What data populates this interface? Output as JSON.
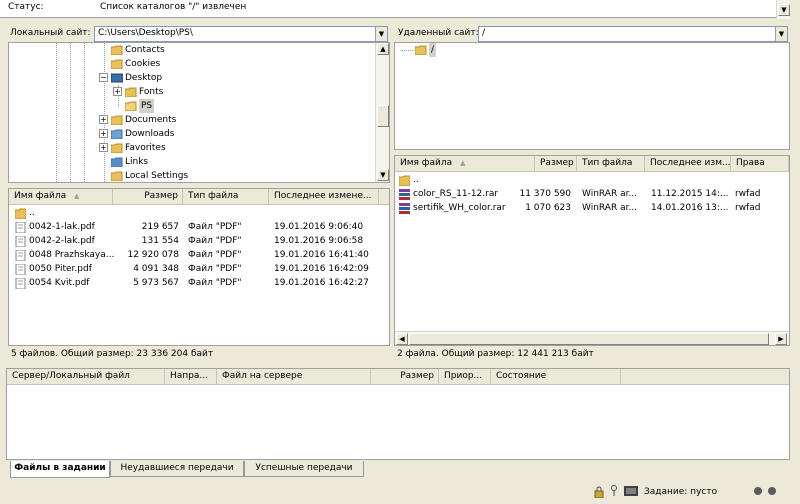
{
  "log": {
    "label": "Статус:",
    "text": "Список каталогов \"/\" извлечен"
  },
  "local": {
    "path_label": "Локальный сайт:",
    "path": "C:\\Users\\Desktop\\PS\\",
    "tree": [
      {
        "label": "Contacts"
      },
      {
        "label": "Cookies"
      },
      {
        "label": "Desktop"
      },
      {
        "label": "Fonts"
      },
      {
        "label": "PS"
      },
      {
        "label": "Documents"
      },
      {
        "label": "Downloads"
      },
      {
        "label": "Favorites"
      },
      {
        "label": "Links"
      },
      {
        "label": "Local Settings"
      }
    ],
    "columns": [
      "Имя файла",
      "Размер",
      "Тип файла",
      "Последнее измене..."
    ],
    "parent": "..",
    "files": [
      {
        "name": "0042-1-lak.pdf",
        "size": "219 657",
        "type": "Файл \"PDF\"",
        "date": "19.01.2016 9:06:40"
      },
      {
        "name": "0042-2-lak.pdf",
        "size": "131 554",
        "type": "Файл \"PDF\"",
        "date": "19.01.2016 9:06:58"
      },
      {
        "name": "0048 Prazhskaya...",
        "size": "12 920 078",
        "type": "Файл \"PDF\"",
        "date": "19.01.2016 16:41:40"
      },
      {
        "name": "0050 Piter.pdf",
        "size": "4 091 348",
        "type": "Файл \"PDF\"",
        "date": "19.01.2016 16:42:09"
      },
      {
        "name": "0054 Kvit.pdf",
        "size": "5 973 567",
        "type": "Файл \"PDF\"",
        "date": "19.01.2016 16:42:27"
      }
    ],
    "summary": "5 файлов. Общий размер: 23 336 204 байт"
  },
  "remote": {
    "path_label": "Удаленный сайт:",
    "path": "/",
    "tree_root": "/",
    "columns": [
      "Имя файла",
      "Размер",
      "Тип файла",
      "Последнее изм...",
      "Права"
    ],
    "parent": "..",
    "files": [
      {
        "name": "color_RS_11-12.rar",
        "size": "11 370 590",
        "type": "WinRAR ar...",
        "date": "11.12.2015 14:...",
        "perm": "rwfad"
      },
      {
        "name": "sertifik_WH_color.rar",
        "size": "1 070 623",
        "type": "WinRAR ar...",
        "date": "14.01.2016 13:...",
        "perm": "rwfad"
      }
    ],
    "summary": "2 файла. Общий размер: 12 441 213 байт"
  },
  "queue": {
    "columns": [
      "Сервер/Локальный файл",
      "Напра...",
      "Файл на сервере",
      "Размер",
      "Приор...",
      "Состояние"
    ],
    "tabs": [
      "Файлы в задании",
      "Неудавшиеся передачи",
      "Успешные передачи"
    ]
  },
  "statusbar": {
    "queue_text": "Задание: пусто"
  },
  "icons": {
    "folder": "folder-icon",
    "pdf": "pdf-file-icon",
    "rar": "winrar-archive-icon",
    "lock": "lock-icon",
    "key": "key-icon"
  }
}
